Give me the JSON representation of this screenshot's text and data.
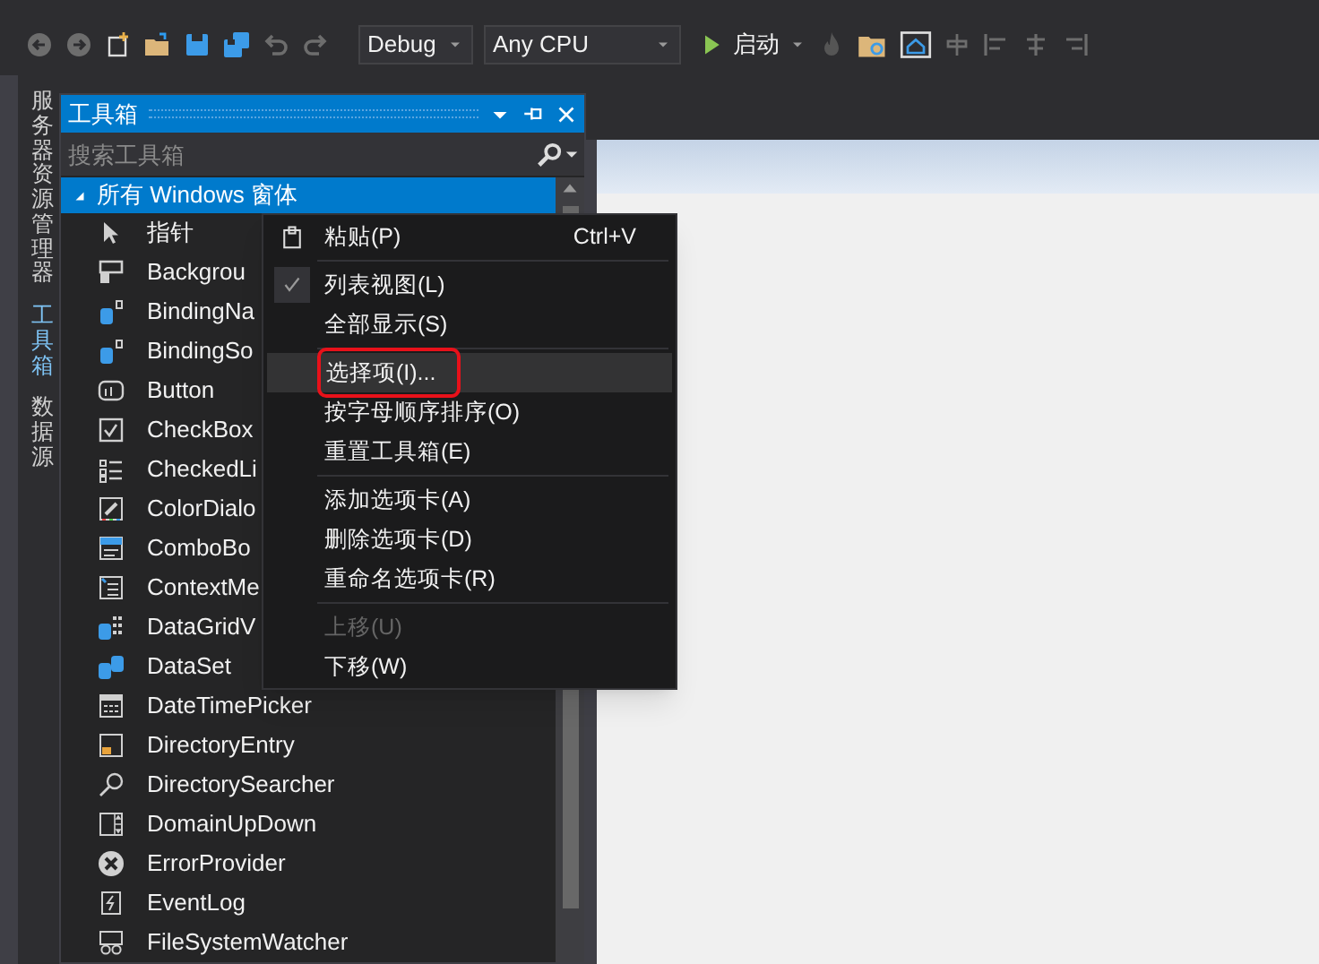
{
  "toolbar": {
    "configuration": "Debug",
    "platform": "Any CPU",
    "start_label": "启动"
  },
  "side_tabs": [
    {
      "label": "服务器资源管理器",
      "selected": false
    },
    {
      "label": "工具箱",
      "selected": true
    },
    {
      "label": "数据源",
      "selected": false
    }
  ],
  "toolbox": {
    "title": "工具箱",
    "search": {
      "placeholder": "搜索工具箱"
    },
    "category": {
      "label": "所有 Windows 窗体",
      "expanded": true,
      "selected": true
    },
    "items": [
      {
        "label": "指针",
        "kind": "pointer"
      },
      {
        "label": "Backgrou",
        "kind": "worker"
      },
      {
        "label": "BindingNa",
        "kind": "binding"
      },
      {
        "label": "BindingSo",
        "kind": "binding"
      },
      {
        "label": "Button",
        "kind": "button"
      },
      {
        "label": "CheckBox",
        "kind": "checkbox"
      },
      {
        "label": "CheckedLi",
        "kind": "list"
      },
      {
        "label": "ColorDialo",
        "kind": "color"
      },
      {
        "label": "ComboBo",
        "kind": "combo"
      },
      {
        "label": "ContextMe",
        "kind": "menu"
      },
      {
        "label": "DataGridV",
        "kind": "grid"
      },
      {
        "label": "DataSet",
        "kind": "dataset"
      },
      {
        "label": "DateTimePicker",
        "kind": "calendar"
      },
      {
        "label": "DirectoryEntry",
        "kind": "directory"
      },
      {
        "label": "DirectorySearcher",
        "kind": "search"
      },
      {
        "label": "DomainUpDown",
        "kind": "updown"
      },
      {
        "label": "ErrorProvider",
        "kind": "error"
      },
      {
        "label": "EventLog",
        "kind": "log"
      },
      {
        "label": "FileSystemWatcher",
        "kind": "watcher"
      }
    ]
  },
  "context_menu": [
    {
      "kind": "item",
      "label": "粘贴(P)",
      "shortcut": "Ctrl+V",
      "icon": true,
      "checked": false,
      "disabled": false,
      "selected": false,
      "outlined": false
    },
    {
      "kind": "separator"
    },
    {
      "kind": "item",
      "label": "列表视图(L)",
      "checked": true,
      "disabled": false,
      "selected": false,
      "outlined": false
    },
    {
      "kind": "item",
      "label": "全部显示(S)",
      "checked": false,
      "disabled": false,
      "selected": false,
      "outlined": false
    },
    {
      "kind": "separator"
    },
    {
      "kind": "item",
      "label": "选择项(I)...",
      "checked": false,
      "disabled": false,
      "selected": true,
      "outlined": true
    },
    {
      "kind": "item",
      "label": "按字母顺序排序(O)",
      "checked": false,
      "disabled": false,
      "selected": false,
      "outlined": false
    },
    {
      "kind": "item",
      "label": "重置工具箱(E)",
      "checked": false,
      "disabled": false,
      "selected": false,
      "outlined": false
    },
    {
      "kind": "separator"
    },
    {
      "kind": "item",
      "label": "添加选项卡(A)",
      "checked": false,
      "disabled": false,
      "selected": false,
      "outlined": false
    },
    {
      "kind": "item",
      "label": "删除选项卡(D)",
      "checked": false,
      "disabled": false,
      "selected": false,
      "outlined": false
    },
    {
      "kind": "item",
      "label": "重命名选项卡(R)",
      "checked": false,
      "disabled": false,
      "selected": false,
      "outlined": false
    },
    {
      "kind": "separator"
    },
    {
      "kind": "item",
      "label": "上移(U)",
      "checked": false,
      "disabled": true,
      "selected": false,
      "outlined": false
    },
    {
      "kind": "item",
      "label": "下移(W)",
      "checked": false,
      "disabled": false,
      "selected": false,
      "outlined": false
    }
  ]
}
